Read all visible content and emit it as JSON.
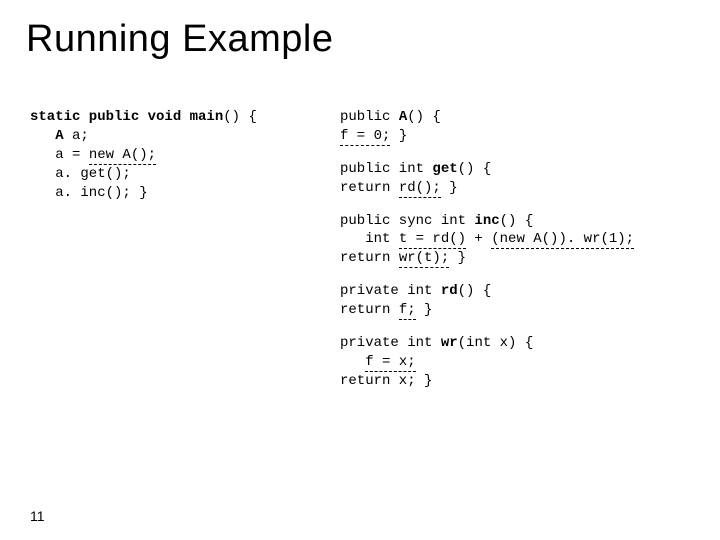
{
  "title": "Running Example",
  "page_number": "11",
  "left": {
    "l1a": "static public void main",
    "l1b": "() {",
    "l2a": "   A",
    "l2b": " a;",
    "l3a": "   a = ",
    "l3u": "new A();",
    "l4": "   a. get();",
    "l5": "   a. inc(); }"
  },
  "r1": {
    "a": "public ",
    "b": "A",
    "c": "() {",
    "d": "f = 0;",
    "e": " }"
  },
  "r2": {
    "a": "public int ",
    "b": "get",
    "c": "() {",
    "d": "return ",
    "e": "rd();",
    "f": " }"
  },
  "r3": {
    "a": "public sync int ",
    "b": "inc",
    "c": "() {",
    "d": "   int ",
    "e": "t = rd()",
    "f": " + ",
    "g": "(new A()). wr(1);",
    "h": "return ",
    "i": "wr(t);",
    "j": " }"
  },
  "r4": {
    "a": "private int ",
    "b": "rd",
    "c": "() {",
    "d": "return ",
    "e": "f;",
    "f": " }"
  },
  "r5": {
    "a": "private int ",
    "b": "wr",
    "c": "(int x) {",
    "d": "   ",
    "e": "f = x;",
    "f": "return x; }"
  }
}
